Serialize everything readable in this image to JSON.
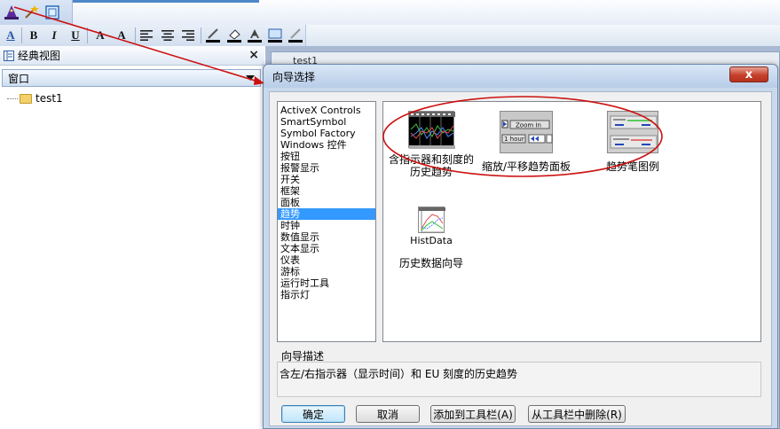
{
  "left_panel": {
    "title": "经典视图",
    "close": "×",
    "combo_value": "窗口",
    "tree_item": "test1"
  },
  "background": {
    "doc_tab": "test1"
  },
  "toolbar2": {
    "font_btn": "A",
    "bold": "B",
    "italic": "I",
    "underline": "U",
    "grow": "A",
    "shrink": "A"
  },
  "dialog": {
    "title": "向导选择",
    "close": "x",
    "categories": [
      "ActiveX Controls",
      "SmartSymbol",
      "Symbol Factory",
      "Windows 控件",
      "按钮",
      "报警显示",
      "开关",
      "框架",
      "面板",
      "趋势",
      "时钟",
      "数值显示",
      "文本显示",
      "仪表",
      "游标",
      "运行时工具",
      "指示灯"
    ],
    "selected_category": "趋势",
    "wizards": [
      {
        "label": "含指示器和刻度的\n历史趋势"
      },
      {
        "label": "缩放/平移趋势面板",
        "thumb_text1": "Zoom In",
        "thumb_text2": "1 hour"
      },
      {
        "label": "趋势笔图例"
      },
      {
        "label": "历史数据向导",
        "thumb_text": "HistData"
      }
    ],
    "description_label": "向导描述",
    "description": "含左/右指示器（显示时间）和 EU 刻度的历史趋势",
    "buttons": {
      "ok": "确定",
      "cancel": "取消",
      "add_toolbar": "添加到工具栏(A)",
      "remove_toolbar": "从工具栏中删除(R)"
    }
  },
  "colors": {
    "selection": "#3399ff",
    "annotation_red": "#cc1111",
    "dialog_frame": "#c9d9ec"
  }
}
